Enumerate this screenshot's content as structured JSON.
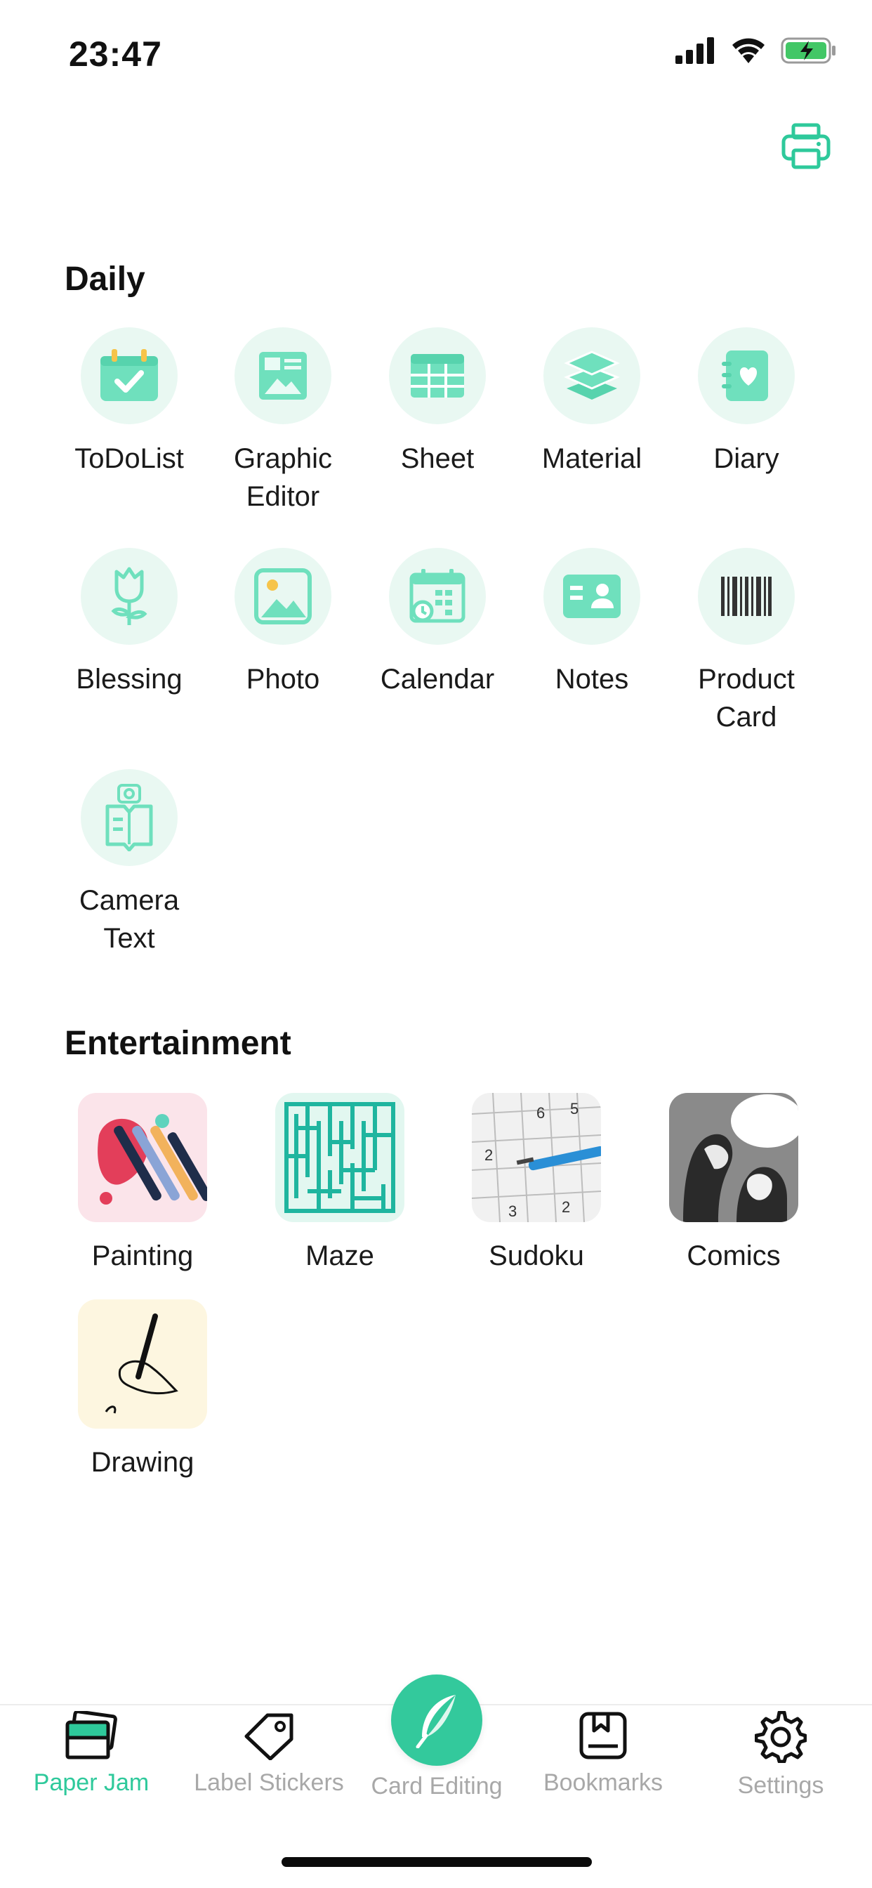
{
  "status_bar": {
    "time": "23:47"
  },
  "header": {
    "printer_icon": "printer-icon"
  },
  "daily": {
    "title": "Daily",
    "items": [
      {
        "label": "ToDoList",
        "icon": "todolist-icon"
      },
      {
        "label": "Graphic\nEditor",
        "icon": "graphic-editor-icon"
      },
      {
        "label": "Sheet",
        "icon": "sheet-icon"
      },
      {
        "label": "Material",
        "icon": "material-icon"
      },
      {
        "label": "Diary",
        "icon": "diary-icon"
      },
      {
        "label": "Blessing",
        "icon": "blessing-icon"
      },
      {
        "label": "Photo",
        "icon": "photo-icon"
      },
      {
        "label": "Calendar",
        "icon": "calendar-icon"
      },
      {
        "label": "Notes",
        "icon": "notes-icon"
      },
      {
        "label": "Product\nCard",
        "icon": "barcode-icon"
      },
      {
        "label": "Camera\nText",
        "icon": "camera-text-icon"
      }
    ]
  },
  "entertainment": {
    "title": "Entertainment",
    "items": [
      {
        "label": "Painting"
      },
      {
        "label": "Maze"
      },
      {
        "label": "Sudoku"
      },
      {
        "label": "Comics"
      },
      {
        "label": "Drawing"
      }
    ]
  },
  "tab_bar": {
    "tabs": [
      {
        "label": "Paper Jam",
        "active": true
      },
      {
        "label": "Label Stickers"
      },
      {
        "label": "Card Editing"
      },
      {
        "label": "Bookmarks"
      },
      {
        "label": "Settings"
      }
    ]
  },
  "colors": {
    "accent": "#2ec99b",
    "icon_bg": "#e9f8f2",
    "icon_fill": "#6fe0bd"
  }
}
